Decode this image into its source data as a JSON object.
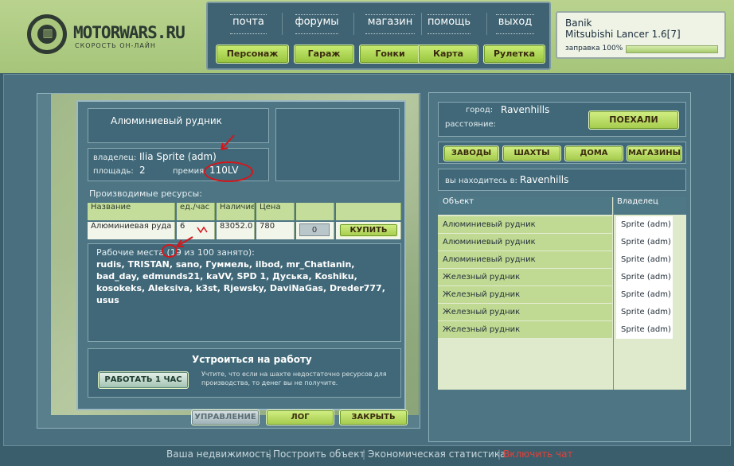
{
  "logo": {
    "title": "MOTORWARS.RU",
    "tagline": "СКОРОСТЬ ОН-ЛАЙН"
  },
  "topnav": [
    {
      "label": "почта"
    },
    {
      "label": "форумы"
    },
    {
      "label": "магазин"
    },
    {
      "label": "помощь"
    },
    {
      "label": "выход"
    }
  ],
  "mainnav": [
    {
      "label": "Персонаж"
    },
    {
      "label": "Гараж"
    },
    {
      "label": "Гонки"
    },
    {
      "label": "Карта"
    },
    {
      "label": "Рулетка"
    }
  ],
  "player": {
    "name": "Banik",
    "car": "Mitsubishi Lancer 1.6[7]",
    "fuel_label": "заправка 100%",
    "fuel_fraction": 1.0
  },
  "building": {
    "title": "Алюминиевый рудник",
    "owner_label": "владелец:",
    "owner": "Ilia Sprite (adm)",
    "area_label": "площадь:",
    "area": "2",
    "bonus_label": "премия:",
    "bonus": "110LV",
    "resources_heading": "Производимые ресурсы:",
    "table": {
      "headers": [
        "Название",
        "ед./час",
        "Наличие",
        "Цена"
      ],
      "row": {
        "name": "Алюминиевая руда",
        "rate": "6",
        "stock": "83052.0",
        "price": "780",
        "qty": "0"
      },
      "buy_label": "КУПИТЬ"
    },
    "workers_heading_pre": "Рабочие места (",
    "workers_count": "19",
    "workers_heading_post": " из 100 занято):",
    "workers_list": "rudis, TRISTAN, sano, Гуммель, ilbod, mr_Chatlanin, bad_day, edmunds21, kaVV, SPD 1, Дуська, Koshiku, kosokeks, Aleksiva, k3st, Rjewsky, DaviNaGas, Dreder777, usus",
    "job_heading": "Устроиться на работу",
    "job_button": "РАБОТАТЬ 1 ЧАС",
    "job_note": "Учтите, что если на шахте недостаточно ресурсов для производства, то денег вы не получите.",
    "bottom_buttons": [
      {
        "label": "УПРАВЛЕНИЕ",
        "enabled": false
      },
      {
        "label": "ЛОГ",
        "enabled": true
      },
      {
        "label": "ЗАКРЫТЬ",
        "enabled": true
      }
    ]
  },
  "travel": {
    "city_label": "город:",
    "city": "Ravenhills",
    "distance_label": "расстояние:",
    "go_button": "ПОЕХАЛИ"
  },
  "categories": [
    {
      "label": "ЗАВОДЫ"
    },
    {
      "label": "ШАХТЫ"
    },
    {
      "label": "ДОМА"
    },
    {
      "label": "МАГАЗИНЫ"
    }
  ],
  "location": {
    "label": "вы находитесь в:",
    "value": "Ravenhills"
  },
  "objects": {
    "headers": [
      "Объект",
      "Владелец"
    ],
    "rows": [
      {
        "object": "Алюминиевый рудник",
        "owner": "Sprite (adm)"
      },
      {
        "object": "Алюминиевый рудник",
        "owner": "Sprite (adm)"
      },
      {
        "object": "Алюминиевый рудник",
        "owner": "Sprite (adm)"
      },
      {
        "object": "Железный рудник",
        "owner": "Sprite (adm)"
      },
      {
        "object": "Железный рудник",
        "owner": "Sprite (adm)"
      },
      {
        "object": "Железный рудник",
        "owner": "Sprite (adm)"
      },
      {
        "object": "Железный рудник",
        "owner": "Sprite (adm)"
      }
    ]
  },
  "footer": [
    {
      "label": "Ваша недвижимость",
      "color": "#c7d6db"
    },
    {
      "label": "Построить объект",
      "color": "#c7d6db"
    },
    {
      "label": "Экономическая статистика",
      "color": "#c7d6db"
    },
    {
      "label": "Включить чат",
      "color": "#e0423a"
    }
  ],
  "colors": {
    "accent_green": "#a4cb4c",
    "panel_blue": "#4d7584",
    "annotation_red": "#d4161b"
  }
}
